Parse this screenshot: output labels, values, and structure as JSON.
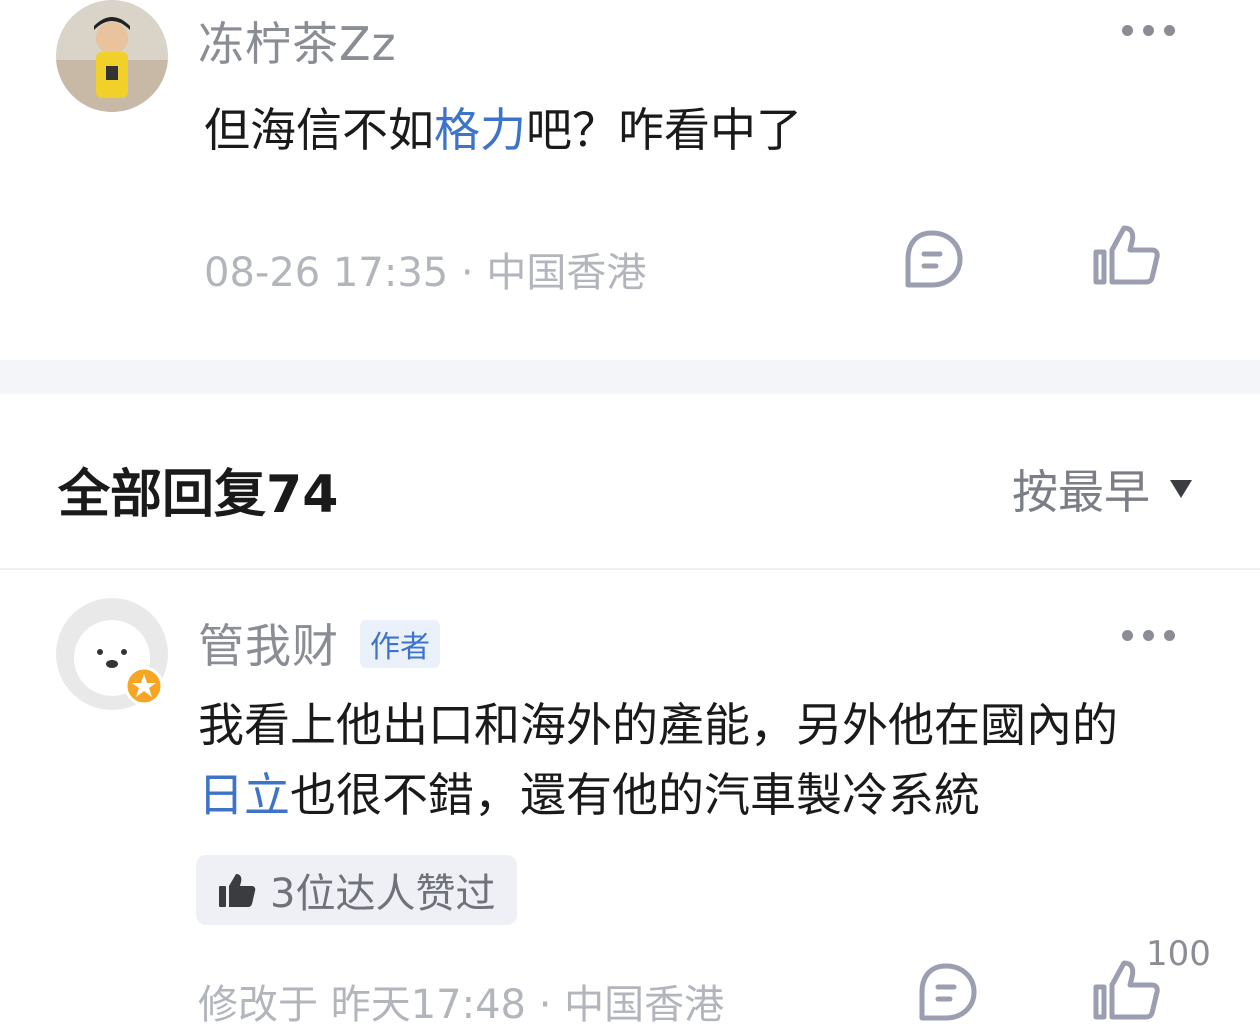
{
  "comment1": {
    "username": "冻柠茶Zz",
    "content_prefix": "但海信不如",
    "content_link": "格力",
    "content_suffix": "吧？咋看中了",
    "meta": "08-26 17:35 · 中国香港"
  },
  "replies_header": {
    "title": "全部回复",
    "count": "74",
    "sort_label": "按最早"
  },
  "comment2": {
    "username": "管我财",
    "author_badge": "作者",
    "content_line1": "我看上他出口和海外的產能，另外他在國內的",
    "content_link": "日立",
    "content_line2_rest": "也很不錯，還有他的汽車製冷系統",
    "likes_summary": "3位达人赞过",
    "meta": "修改于 昨天17:48 · 中国香港",
    "like_count": "100"
  },
  "colors": {
    "link": "#3d74c9",
    "muted": "#b2b5bb",
    "icon": "#9a9eb0"
  },
  "icons": [
    "more-icon",
    "comment-icon",
    "thumbs-up-icon",
    "sort-dropdown-icon"
  ]
}
